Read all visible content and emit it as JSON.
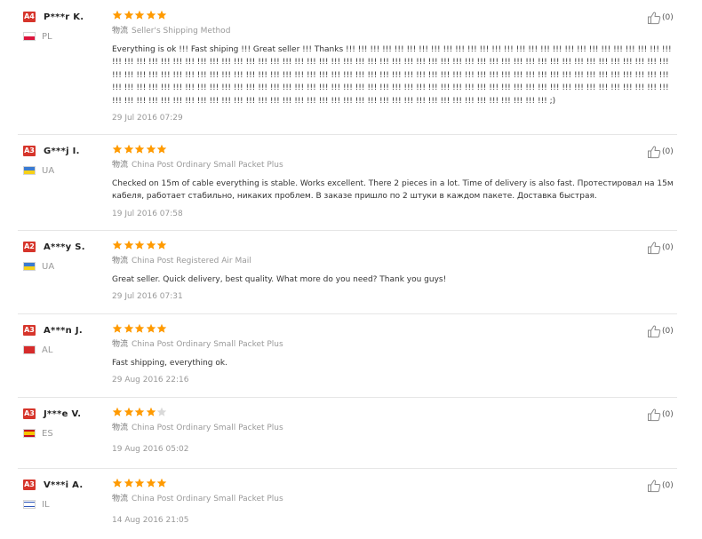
{
  "logistics_label": "物流",
  "reviews": [
    {
      "level": "A4",
      "username": "P***r K.",
      "country": "PL",
      "rating": 5,
      "logistics": "Seller's Shipping Method",
      "text": "Everything is ok !!! Fast shiping !!! Great seller !!! Thanks !!! !!! !!! !!! !!! !!! !!! !!! !!! !!! !!! !!! !!! !!! !!! !!! !!! !!! !!! !!! !!! !!! !!! !!! !!! !!! !!! !!! !!! !!! !!! !!! !!! !!! !!! !!! !!! !!! !!! !!! !!! !!! !!! !!! !!! !!! !!! !!! !!! !!! !!! !!! !!! !!! !!! !!! !!! !!! !!! !!! !!! !!! !!! !!! !!! !!! !!! !!! !!! !!! !!! !!! !!! !!! !!! !!! !!! !!! !!! !!! !!! !!! !!! !!! !!! !!! !!! !!! !!! !!! !!! !!! !!! !!! !!! !!! !!! !!! !!! !!! !!! !!! !!! !!! !!! !!! !!! !!! !!! !!! !!! !!! !!! !!! !!! !!! !!! !!! !!! !!! !!! !!! !!! !!! !!! !!! !!! !!! !!! !!! !!! !!! !!! !!! !!! !!! !!! !!! !!! !!! !!! !!! !!! !!! !!! !!! !!! !!! !!! !!! !!! !!! !!! !!! !!! !!! !!! !!! !!! !!! !!! !!! !!! !!! !!! !!! !!! !!! !!! !!! !!! !!! !!! !!! !!! !!! !!! !!! !!! !!! !!! !!! !!! !!! !!! !!! !!! !!! !!! !!! !!! !!! !!! !!! !!! !!! !!! !!! !!! !!! !!! ;)",
      "date": "29 Jul 2016 07:29",
      "helpful": "(0)"
    },
    {
      "level": "A3",
      "username": "G***j I.",
      "country": "UA",
      "rating": 5,
      "logistics": "China Post Ordinary Small Packet Plus",
      "text": "Checked on 15m of cable everything is stable. Works excellent. There 2 pieces in a lot. Time of delivery is also fast. Протестировал на 15м кабеля, работает стабильно, никаких проблем. В заказе пришло по 2 штуки в каждом пакете. Доставка быстрая.",
      "date": "19 Jul 2016 07:58",
      "helpful": "(0)"
    },
    {
      "level": "A2",
      "username": "A***y S.",
      "country": "UA",
      "rating": 5,
      "logistics": "China Post Registered Air Mail",
      "text": "Great seller. Quick delivery, best quality. What more do you need? Thank you guys!",
      "date": "29 Jul 2016 07:31",
      "helpful": "(0)"
    },
    {
      "level": "A3",
      "username": "A***n J.",
      "country": "AL",
      "rating": 5,
      "logistics": "China Post Ordinary Small Packet Plus",
      "text": "Fast shipping, everything ok.",
      "date": "29 Aug 2016 22:16",
      "helpful": "(0)"
    },
    {
      "level": "A3",
      "username": "J***e V.",
      "country": "ES",
      "rating": 4,
      "logistics": "China Post Ordinary Small Packet Plus",
      "text": "",
      "date": "19 Aug 2016 05:02",
      "helpful": "(0)"
    },
    {
      "level": "A3",
      "username": "V***i A.",
      "country": "IL",
      "rating": 5,
      "logistics": "China Post Ordinary Small Packet Plus",
      "text": "",
      "date": "14 Aug 2016 21:05",
      "helpful": "(0)"
    }
  ],
  "colors": {
    "level_badge": "#d6352b",
    "star_on": "#ff9a00",
    "star_off": "#d9d9d9",
    "separator": "#e6e6e6"
  }
}
